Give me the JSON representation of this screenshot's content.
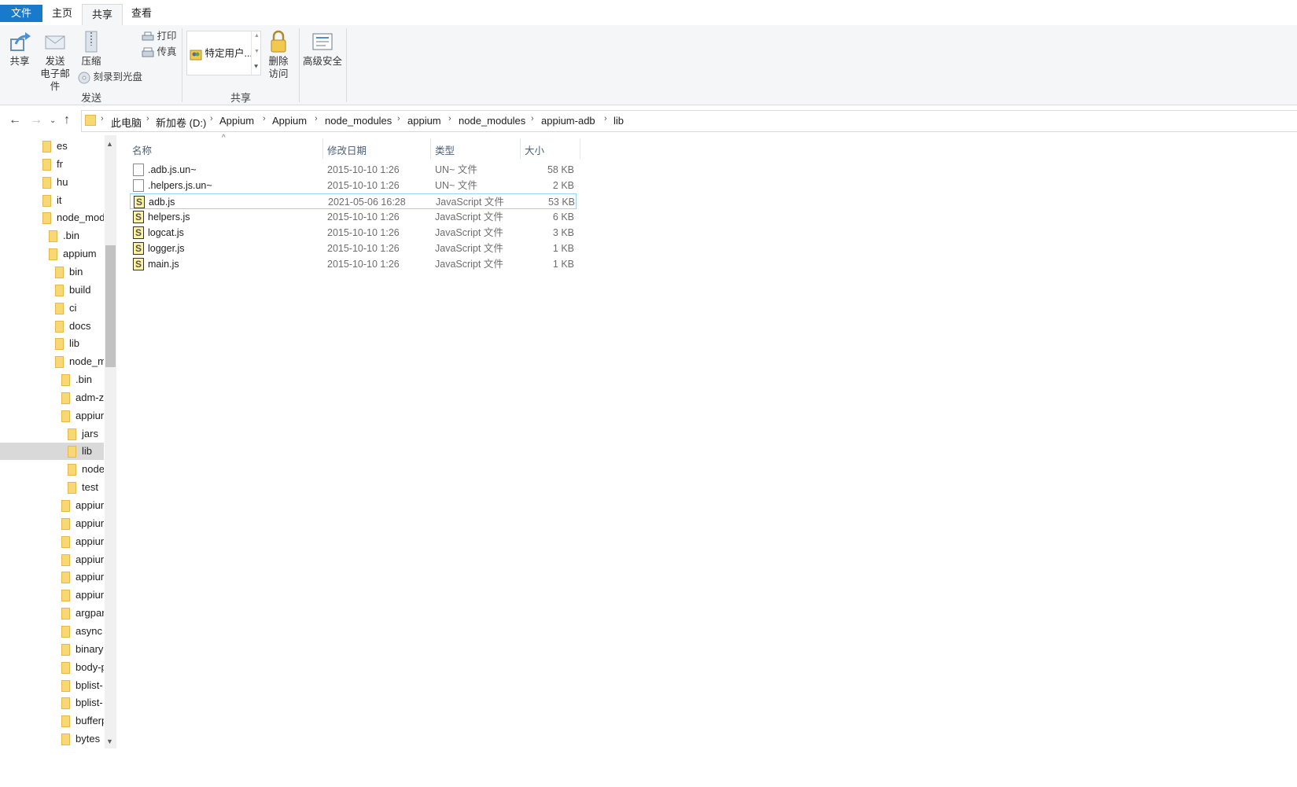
{
  "ribbon_tabs": {
    "file": "文件",
    "home": "主页",
    "share": "共享",
    "view": "查看"
  },
  "ribbon": {
    "send_group": {
      "label": "发送",
      "share": "共享",
      "email_line1": "发送",
      "email_line2": "电子邮件",
      "zip": "压缩",
      "print": "打印",
      "fax": "传真",
      "burn": "刻录到光盘"
    },
    "share_group": {
      "label": "共享",
      "specific_users": "特定用户...",
      "remove_access_line1": "删除",
      "remove_access_line2": "访问",
      "advanced_security": "高级安全"
    }
  },
  "breadcrumb": [
    "此电脑",
    "新加卷 (D:)",
    "Appium",
    "Appium",
    "node_modules",
    "appium",
    "node_modules",
    "appium-adb",
    "lib"
  ],
  "nav_tree": [
    {
      "label": "es",
      "indent": 0
    },
    {
      "label": "fr",
      "indent": 0
    },
    {
      "label": "hu",
      "indent": 0
    },
    {
      "label": "it",
      "indent": 0
    },
    {
      "label": "node_mod",
      "indent": 0
    },
    {
      "label": ".bin",
      "indent": 1
    },
    {
      "label": "appium",
      "indent": 1
    },
    {
      "label": "bin",
      "indent": 2
    },
    {
      "label": "build",
      "indent": 2
    },
    {
      "label": "ci",
      "indent": 2
    },
    {
      "label": "docs",
      "indent": 2
    },
    {
      "label": "lib",
      "indent": 2
    },
    {
      "label": "node_m",
      "indent": 2
    },
    {
      "label": ".bin",
      "indent": 3
    },
    {
      "label": "adm-z",
      "indent": 3
    },
    {
      "label": "appiun",
      "indent": 3
    },
    {
      "label": "jars",
      "indent": 4
    },
    {
      "label": "lib",
      "indent": 4,
      "selected": true
    },
    {
      "label": "node",
      "indent": 4
    },
    {
      "label": "test",
      "indent": 4
    },
    {
      "label": "appiur",
      "indent": 3
    },
    {
      "label": "appiur",
      "indent": 3
    },
    {
      "label": "appiur",
      "indent": 3
    },
    {
      "label": "appiur",
      "indent": 3
    },
    {
      "label": "appiur",
      "indent": 3
    },
    {
      "label": "appiur",
      "indent": 3
    },
    {
      "label": "argpar",
      "indent": 3
    },
    {
      "label": "async",
      "indent": 3
    },
    {
      "label": "binary-",
      "indent": 3
    },
    {
      "label": "body-p",
      "indent": 3
    },
    {
      "label": "bplist-",
      "indent": 3
    },
    {
      "label": "bplist-",
      "indent": 3
    },
    {
      "label": "bufferp",
      "indent": 3
    },
    {
      "label": "bytes",
      "indent": 3
    }
  ],
  "columns": {
    "name": "名称",
    "modified": "修改日期",
    "type": "类型",
    "size": "大小"
  },
  "files": [
    {
      "name": ".adb.js.un~",
      "modified": "2015-10-10 1:26",
      "type": "UN~ 文件",
      "size": "58 KB",
      "icon": "blank-file-icon"
    },
    {
      "name": ".helpers.js.un~",
      "modified": "2015-10-10 1:26",
      "type": "UN~ 文件",
      "size": "2 KB",
      "icon": "blank-file-icon"
    },
    {
      "name": "adb.js",
      "modified": "2021-05-06 16:28",
      "type": "JavaScript 文件",
      "size": "53 KB",
      "icon": "js-file-icon",
      "selected": true
    },
    {
      "name": "helpers.js",
      "modified": "2015-10-10 1:26",
      "type": "JavaScript 文件",
      "size": "6 KB",
      "icon": "js-file-icon"
    },
    {
      "name": "logcat.js",
      "modified": "2015-10-10 1:26",
      "type": "JavaScript 文件",
      "size": "3 KB",
      "icon": "js-file-icon"
    },
    {
      "name": "logger.js",
      "modified": "2015-10-10 1:26",
      "type": "JavaScript 文件",
      "size": "1 KB",
      "icon": "js-file-icon"
    },
    {
      "name": "main.js",
      "modified": "2015-10-10 1:26",
      "type": "JavaScript 文件",
      "size": "1 KB",
      "icon": "js-file-icon"
    }
  ]
}
